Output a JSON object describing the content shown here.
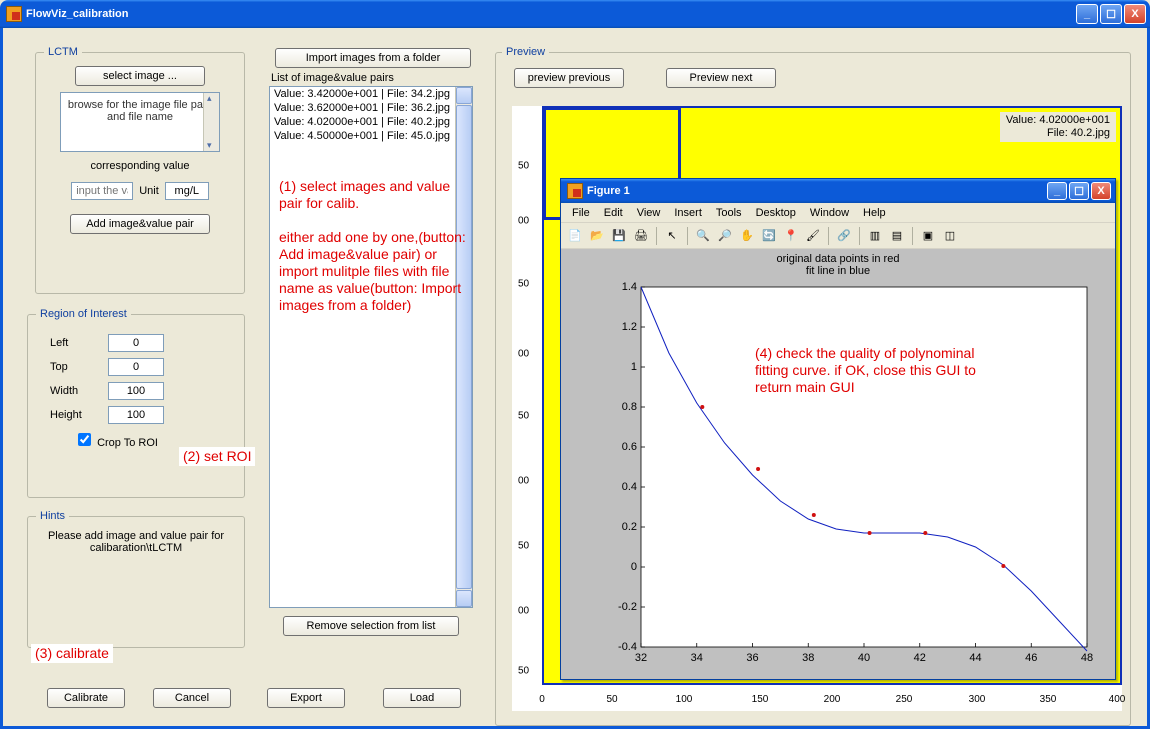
{
  "window": {
    "title": "FlowViz_calibration"
  },
  "titlebar_buttons": {
    "min": "_",
    "max": "☐",
    "close": "X"
  },
  "lctm": {
    "legend": "LCTM",
    "select_image_btn": "select image ...",
    "browse_hint": "browse for the image file path and file name",
    "corresponding_label": "corresponding value",
    "value_placeholder": "input the valu",
    "unit_label": "Unit",
    "unit_value": "mg/L",
    "add_pair_btn": "Add image&value pair"
  },
  "roi": {
    "legend": "Region of Interest",
    "left_label": "Left",
    "left_value": "0",
    "top_label": "Top",
    "top_value": "0",
    "width_label": "Width",
    "width_value": "100",
    "height_label": "Height",
    "height_value": "100",
    "crop_label": "Crop To ROI",
    "crop_checked": true
  },
  "hints": {
    "legend": "Hints",
    "text": "Please add image and value pair for calibaration\\tLCTM"
  },
  "list": {
    "import_btn": "Import images from a folder",
    "label": "List of image&value pairs",
    "items": [
      "Value: 3.42000e+001 | File: 34.2.jpg",
      "Value: 3.62000e+001 | File: 36.2.jpg",
      "Value: 4.02000e+001 | File: 40.2.jpg",
      "Value: 4.50000e+001 | File: 45.0.jpg"
    ],
    "remove_btn": "Remove selection from list"
  },
  "preview": {
    "legend": "Preview",
    "prev_btn": "preview previous",
    "next_btn": "Preview next",
    "info_line1": "Value: 4.02000e+001",
    "info_line2": "File: 40.2.jpg",
    "yticks": [
      "50",
      "00",
      "50",
      "00",
      "50",
      "00",
      "50",
      "00",
      "50"
    ],
    "xticks": [
      "0",
      "50",
      "100",
      "150",
      "200",
      "250",
      "300",
      "350",
      "400"
    ]
  },
  "buttons": {
    "calibrate": "Calibrate",
    "cancel": "Cancel",
    "export": "Export",
    "load": "Load"
  },
  "annotations": {
    "a1": "(1) select images and value pair for calib.\n\neither add one by one,(button: Add image&value pair) or import mulitple files with file name as value(button: Import images from a folder)",
    "a2": "(2) set ROI",
    "a3": "(3) calibrate",
    "a4": "(4) check the quality of polynominal fitting curve. if OK, close this GUI to return main GUI"
  },
  "figure": {
    "title": "Figure 1",
    "menus": [
      "File",
      "Edit",
      "View",
      "Insert",
      "Tools",
      "Desktop",
      "Window",
      "Help"
    ],
    "plot_title1": "original data points in red",
    "plot_title2": "fit line in blue",
    "xticks": [
      "32",
      "34",
      "36",
      "38",
      "40",
      "42",
      "44",
      "46",
      "48"
    ],
    "yticks": [
      "-0.4",
      "-0.2",
      "0",
      "0.2",
      "0.4",
      "0.6",
      "0.8",
      "1",
      "1.2",
      "1.4"
    ]
  },
  "chart_data": {
    "type": "line",
    "title": "original data points in red / fit line in blue",
    "xlabel": "",
    "ylabel": "",
    "xlim": [
      32,
      48
    ],
    "ylim": [
      -0.4,
      1.4
    ],
    "series": [
      {
        "name": "fit line",
        "color": "#1020c0",
        "x": [
          32,
          33,
          34,
          35,
          36,
          37,
          38,
          39,
          40,
          41,
          42,
          43,
          44,
          45,
          46,
          47,
          48
        ],
        "y": [
          1.4,
          1.07,
          0.82,
          0.62,
          0.46,
          0.33,
          0.24,
          0.19,
          0.17,
          0.17,
          0.17,
          0.15,
          0.1,
          0.01,
          -0.12,
          -0.27,
          -0.42
        ]
      }
    ],
    "points": {
      "name": "original data points",
      "color": "#d01010",
      "x": [
        34.2,
        36.2,
        38.2,
        40.2,
        42.2,
        45.0
      ],
      "y": [
        0.8,
        0.49,
        0.26,
        0.17,
        0.17,
        0.005
      ]
    }
  }
}
